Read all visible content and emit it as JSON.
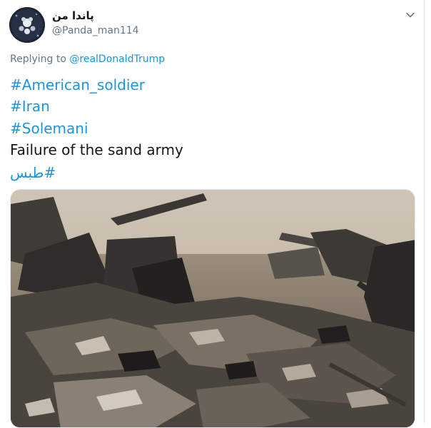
{
  "author": {
    "display_name": "پاندا من",
    "handle": "@Panda_man114"
  },
  "reply": {
    "prefix": "Replying to",
    "target": "@realDonaldTrump"
  },
  "body": {
    "hashtag_1": "#American_soldier",
    "hashtag_2": "#Iran",
    "hashtag_3": "#Solemani",
    "text": "Failure of the sand army",
    "hashtag_4": "طبس#"
  },
  "icons": {
    "menu": "chevron-down-icon",
    "avatar": "avatar"
  },
  "colors": {
    "link": "#1b95e0",
    "text": "#14171a",
    "muted": "#657786"
  }
}
